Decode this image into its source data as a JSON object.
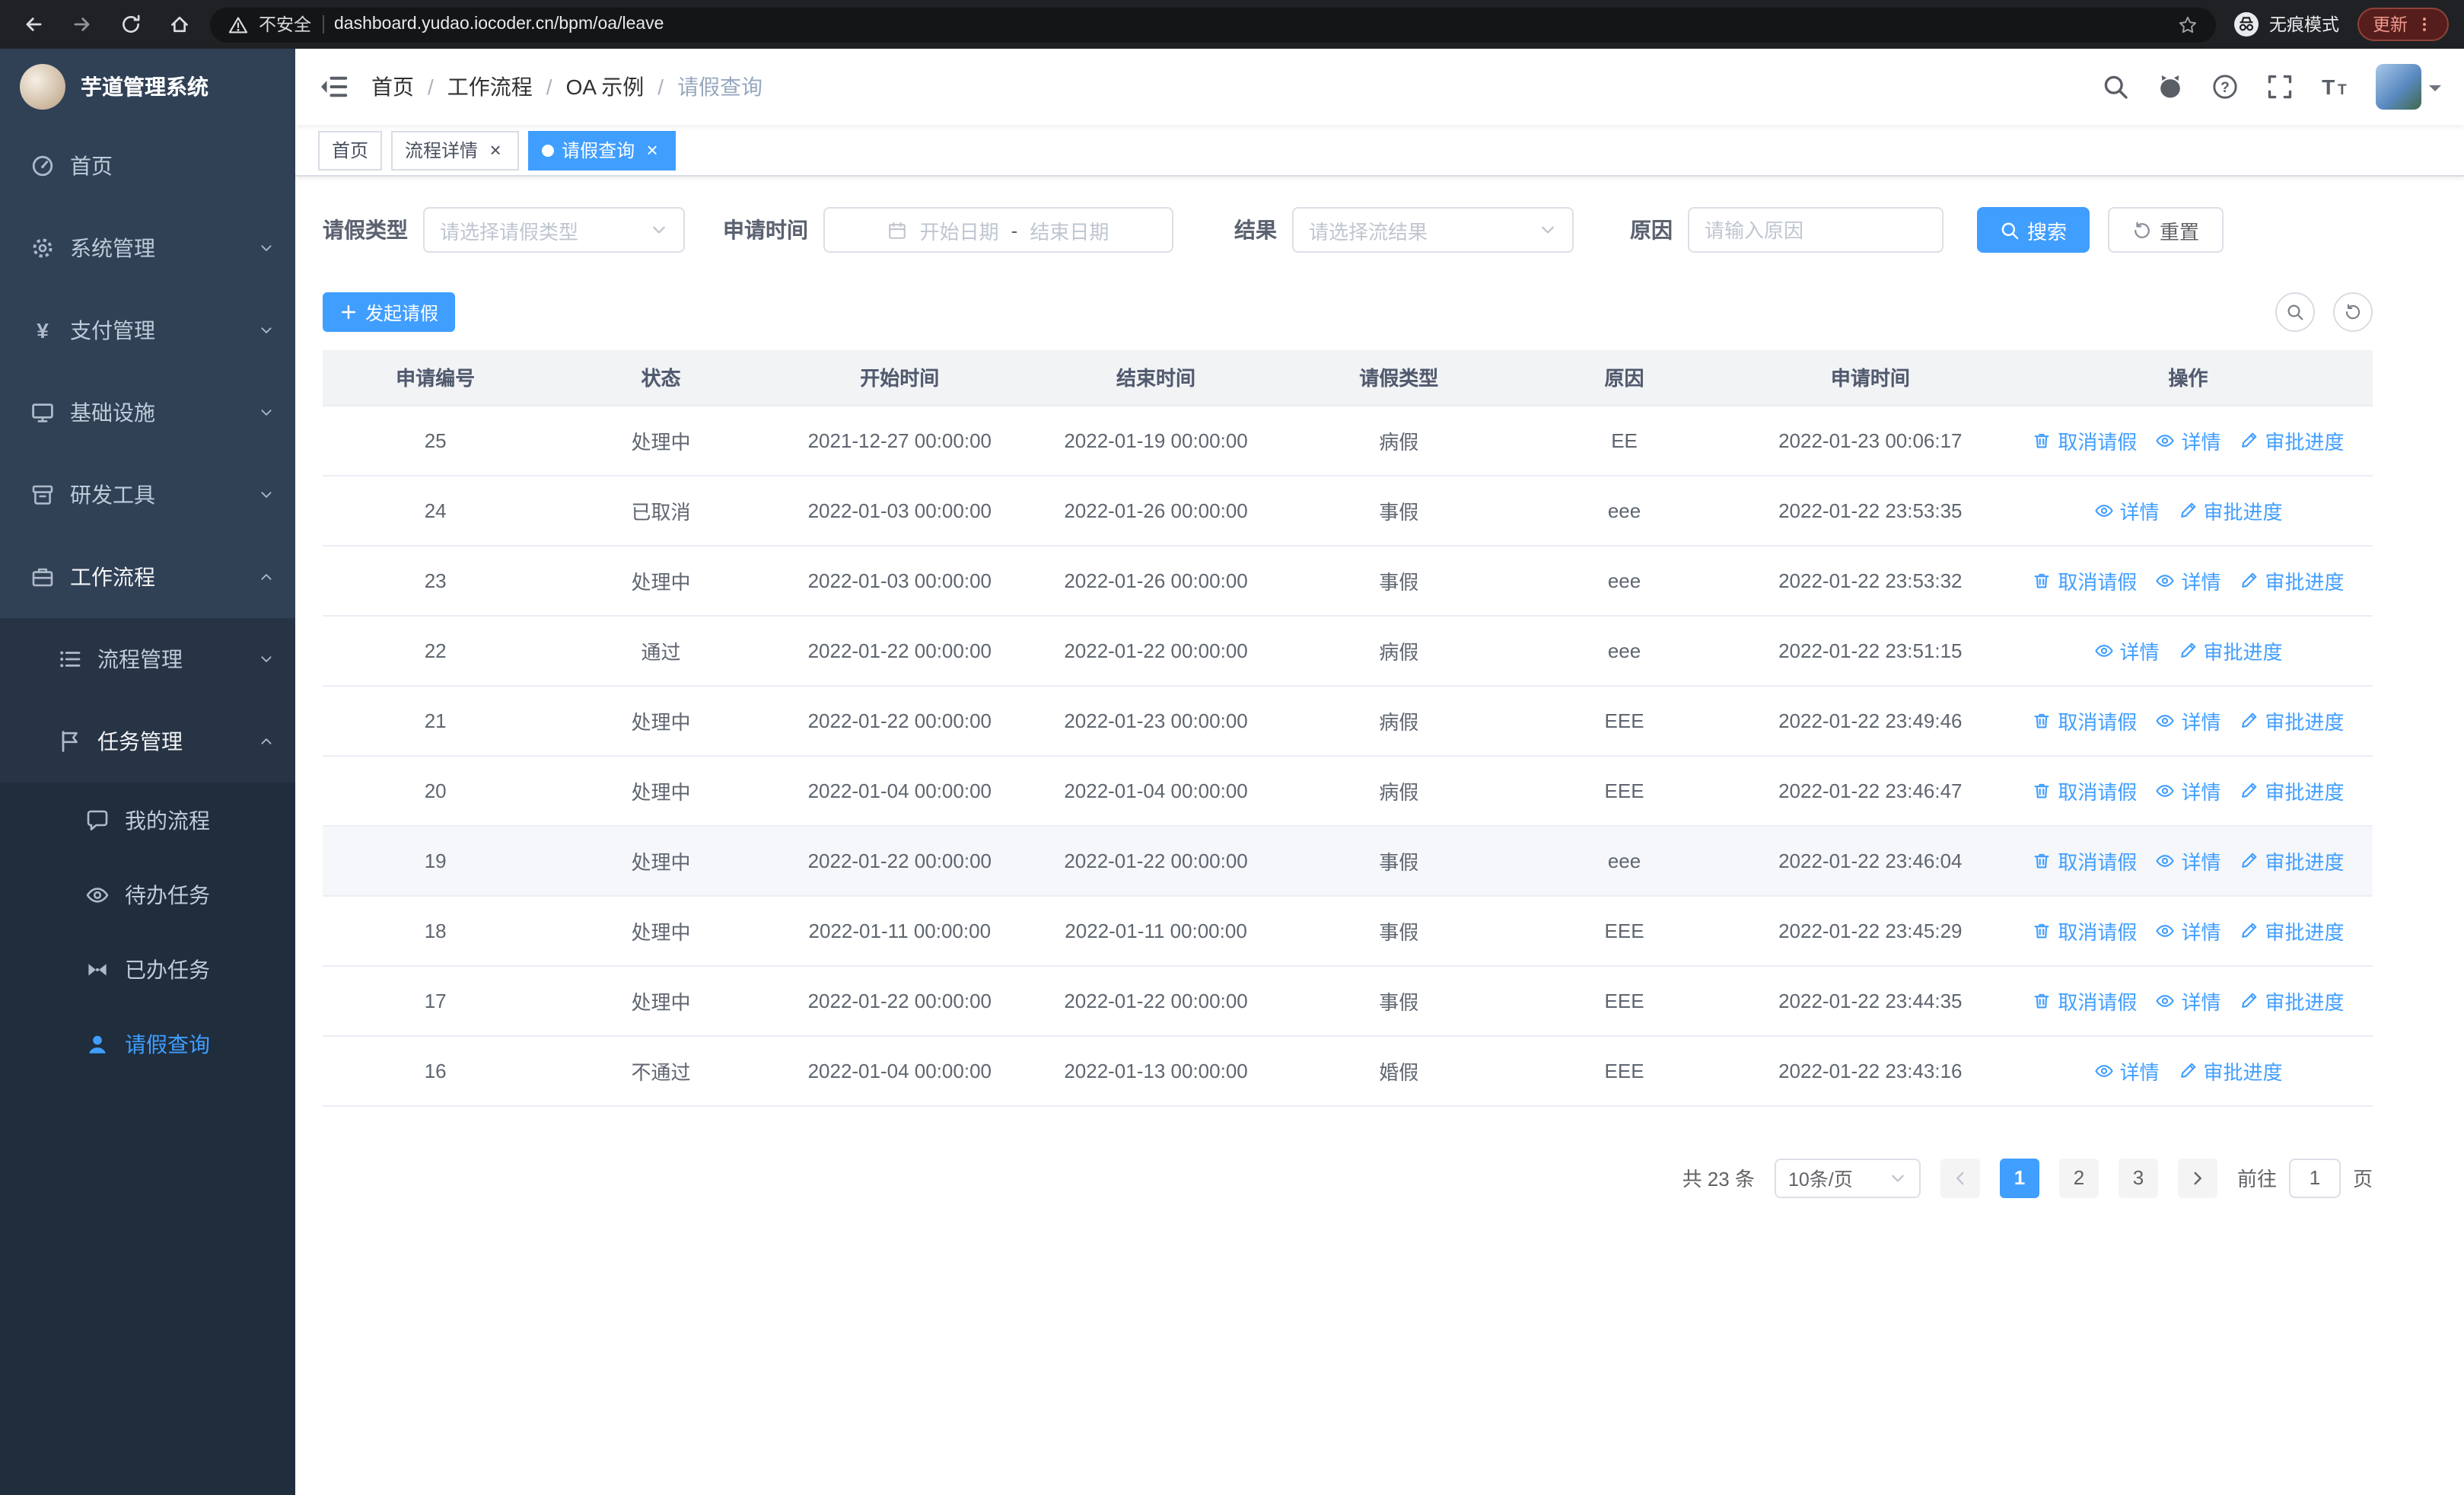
{
  "browser": {
    "security_warning": "不安全",
    "url": "dashboard.yudao.iocoder.cn/bpm/oa/leave",
    "incognito_label": "无痕模式",
    "update_label": "更新"
  },
  "sidebar": {
    "logo_title": "芋道管理系统",
    "items": [
      {
        "name": "home",
        "label": "首页",
        "icon": "dashboard-icon",
        "level": 1
      },
      {
        "name": "system-management",
        "label": "系统管理",
        "icon": "gear-icon",
        "level": 1,
        "arrow": "down"
      },
      {
        "name": "payment-management",
        "label": "支付管理",
        "icon": "yen-icon",
        "level": 1,
        "arrow": "down"
      },
      {
        "name": "infrastructure",
        "label": "基础设施",
        "icon": "monitor-icon",
        "level": 1,
        "arrow": "down"
      },
      {
        "name": "dev-tools",
        "label": "研发工具",
        "icon": "archive-icon",
        "level": 1,
        "arrow": "down"
      },
      {
        "name": "workflow",
        "label": "工作流程",
        "icon": "briefcase-icon",
        "level": 1,
        "arrow": "up",
        "expanded": true
      },
      {
        "name": "process-management",
        "label": "流程管理",
        "icon": "flow-icon",
        "level": 2,
        "arrow": "down"
      },
      {
        "name": "task-management",
        "label": "任务管理",
        "icon": "flag-icon",
        "level": 2,
        "arrow": "up",
        "expanded": true
      },
      {
        "name": "my-process",
        "label": "我的流程",
        "icon": "chat-icon",
        "level": 3
      },
      {
        "name": "todo-tasks",
        "label": "待办任务",
        "icon": "eye-icon",
        "level": 3
      },
      {
        "name": "done-tasks",
        "label": "已办任务",
        "icon": "bowtie-icon",
        "level": 3
      },
      {
        "name": "leave-query",
        "label": "请假查询",
        "icon": "user-icon",
        "level": 3,
        "active": true
      }
    ]
  },
  "header": {
    "breadcrumb": [
      "首页",
      "工作流程",
      "OA 示例",
      "请假查询"
    ]
  },
  "tabs": [
    {
      "name": "home",
      "label": "首页",
      "closable": false,
      "active": false
    },
    {
      "name": "process-detail",
      "label": "流程详情",
      "closable": true,
      "active": false
    },
    {
      "name": "leave-query",
      "label": "请假查询",
      "closable": true,
      "active": true
    }
  ],
  "filters": {
    "leave_type_label": "请假类型",
    "leave_type_placeholder": "请选择请假类型",
    "apply_time_label": "申请时间",
    "date_start_placeholder": "开始日期",
    "date_separator": "-",
    "date_end_placeholder": "结束日期",
    "result_label": "结果",
    "result_placeholder": "请选择流结果",
    "reason_label": "原因",
    "reason_placeholder": "请输入原因",
    "search_button": "搜索",
    "reset_button": "重置"
  },
  "toolbar": {
    "create_button": "发起请假"
  },
  "table": {
    "columns": [
      "申请编号",
      "状态",
      "开始时间",
      "结束时间",
      "请假类型",
      "原因",
      "申请时间",
      "操作"
    ],
    "action_labels": {
      "cancel": "取消请假",
      "detail": "详情",
      "progress": "审批进度"
    },
    "rows": [
      {
        "id": "25",
        "status": "处理中",
        "start": "2021-12-27 00:00:00",
        "end": "2022-01-19 00:00:00",
        "type": "病假",
        "reason": "EE",
        "apply_time": "2022-01-23 00:06:17",
        "actions": [
          "cancel",
          "detail",
          "progress"
        ]
      },
      {
        "id": "24",
        "status": "已取消",
        "start": "2022-01-03 00:00:00",
        "end": "2022-01-26 00:00:00",
        "type": "事假",
        "reason": "eee",
        "apply_time": "2022-01-22 23:53:35",
        "actions": [
          "detail",
          "progress"
        ]
      },
      {
        "id": "23",
        "status": "处理中",
        "start": "2022-01-03 00:00:00",
        "end": "2022-01-26 00:00:00",
        "type": "事假",
        "reason": "eee",
        "apply_time": "2022-01-22 23:53:32",
        "actions": [
          "cancel",
          "detail",
          "progress"
        ]
      },
      {
        "id": "22",
        "status": "通过",
        "start": "2022-01-22 00:00:00",
        "end": "2022-01-22 00:00:00",
        "type": "病假",
        "reason": "eee",
        "apply_time": "2022-01-22 23:51:15",
        "actions": [
          "detail",
          "progress"
        ]
      },
      {
        "id": "21",
        "status": "处理中",
        "start": "2022-01-22 00:00:00",
        "end": "2022-01-23 00:00:00",
        "type": "病假",
        "reason": "EEE",
        "apply_time": "2022-01-22 23:49:46",
        "actions": [
          "cancel",
          "detail",
          "progress"
        ]
      },
      {
        "id": "20",
        "status": "处理中",
        "start": "2022-01-04 00:00:00",
        "end": "2022-01-04 00:00:00",
        "type": "病假",
        "reason": "EEE",
        "apply_time": "2022-01-22 23:46:47",
        "actions": [
          "cancel",
          "detail",
          "progress"
        ]
      },
      {
        "id": "19",
        "status": "处理中",
        "start": "2022-01-22 00:00:00",
        "end": "2022-01-22 00:00:00",
        "type": "事假",
        "reason": "eee",
        "apply_time": "2022-01-22 23:46:04",
        "actions": [
          "cancel",
          "detail",
          "progress"
        ],
        "highlight": true
      },
      {
        "id": "18",
        "status": "处理中",
        "start": "2022-01-11 00:00:00",
        "end": "2022-01-11 00:00:00",
        "type": "事假",
        "reason": "EEE",
        "apply_time": "2022-01-22 23:45:29",
        "actions": [
          "cancel",
          "detail",
          "progress"
        ]
      },
      {
        "id": "17",
        "status": "处理中",
        "start": "2022-01-22 00:00:00",
        "end": "2022-01-22 00:00:00",
        "type": "事假",
        "reason": "EEE",
        "apply_time": "2022-01-22 23:44:35",
        "actions": [
          "cancel",
          "detail",
          "progress"
        ]
      },
      {
        "id": "16",
        "status": "不通过",
        "start": "2022-01-04 00:00:00",
        "end": "2022-01-13 00:00:00",
        "type": "婚假",
        "reason": "EEE",
        "apply_time": "2022-01-22 23:43:16",
        "actions": [
          "detail",
          "progress"
        ]
      }
    ]
  },
  "pagination": {
    "total_text": "共 23 条",
    "page_size": "10条/页",
    "pages": [
      "1",
      "2",
      "3"
    ],
    "active_page": "1",
    "goto_label": "前往",
    "goto_value": "1",
    "goto_suffix": "页"
  },
  "colors": {
    "primary": "#409eff",
    "sidebar_bg": "#304156",
    "sidebar_submenu_bg": "#263445",
    "sidebar_deep_bg": "#1f2d3d",
    "table_header_bg": "#f2f3f5",
    "highlight_row_bg": "#f5f7fa"
  }
}
